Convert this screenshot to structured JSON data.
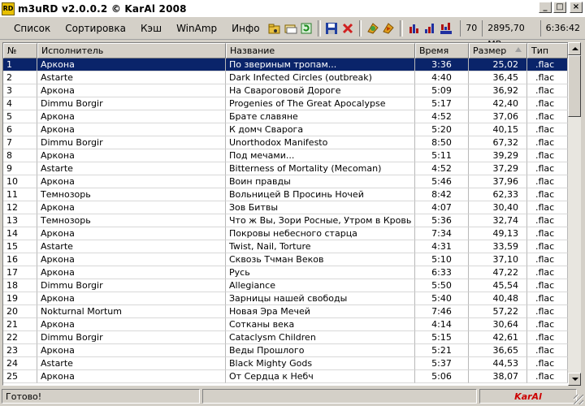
{
  "window": {
    "title": "m3uRD v2.0.0.2  © KarAl 2008",
    "icon_text": "RD"
  },
  "menu": [
    "Список",
    "Сортировка",
    "Кэш",
    "WinAmp",
    "Инфо"
  ],
  "toolbar_icons": [
    "folder-music-icon",
    "open-folder-icon",
    "refresh-icon",
    "save-icon",
    "delete-icon",
    "winamp-add-icon",
    "winamp-play-icon",
    "chart-icon",
    "chart-sorted-icon",
    "chart-random-icon"
  ],
  "stats": {
    "count": "70",
    "size": "2895,70 MB",
    "duration": "6:36:42"
  },
  "columns": [
    "№",
    "Исполнитель",
    "Название",
    "Время",
    "Размер",
    "Тип"
  ],
  "rows": [
    {
      "n": "1",
      "artist": "Аркона",
      "title": "По звериным тропам...",
      "time": "3:36",
      "size": "25,02",
      "type": ".flac"
    },
    {
      "n": "2",
      "artist": "Astarte",
      "title": "Dark Infected Circles (outbreak)",
      "time": "4:40",
      "size": "36,45",
      "type": ".flac"
    },
    {
      "n": "3",
      "artist": "Аркона",
      "title": "На Сварогововй Дороге",
      "time": "5:09",
      "size": "36,92",
      "type": ".flac"
    },
    {
      "n": "4",
      "artist": "Dimmu Borgir",
      "title": "Progenies of The Great Apocalypse",
      "time": "5:17",
      "size": "42,40",
      "type": ".flac"
    },
    {
      "n": "5",
      "artist": "Аркона",
      "title": "Брате славяне",
      "time": "4:52",
      "size": "37,06",
      "type": ".flac"
    },
    {
      "n": "6",
      "artist": "Аркона",
      "title": "К домч Сварога",
      "time": "5:20",
      "size": "40,15",
      "type": ".flac"
    },
    {
      "n": "7",
      "artist": "Dimmu Borgir",
      "title": "Unorthodox Manifesto",
      "time": "8:50",
      "size": "67,32",
      "type": ".flac"
    },
    {
      "n": "8",
      "artist": "Аркона",
      "title": "Под мечами...",
      "time": "5:11",
      "size": "39,29",
      "type": ".flac"
    },
    {
      "n": "9",
      "artist": "Astarte",
      "title": "Bitterness of Mortality (Mecoman)",
      "time": "4:52",
      "size": "37,29",
      "type": ".flac"
    },
    {
      "n": "10",
      "artist": "Аркона",
      "title": "Воин правды",
      "time": "5:46",
      "size": "37,96",
      "type": ".flac"
    },
    {
      "n": "11",
      "artist": "Темнозорь",
      "title": "Вольницей В Просинь Ночей",
      "time": "8:42",
      "size": "62,33",
      "type": ".flac"
    },
    {
      "n": "12",
      "artist": "Аркона",
      "title": "Зов Битвы",
      "time": "4:07",
      "size": "30,40",
      "type": ".flac"
    },
    {
      "n": "13",
      "artist": "Темнозорь",
      "title": "Что ж Вы, Зори Росные, Утром в Кровь Б...",
      "time": "5:36",
      "size": "32,74",
      "type": ".flac"
    },
    {
      "n": "14",
      "artist": "Аркона",
      "title": "Покровы небесного старца",
      "time": "7:34",
      "size": "49,13",
      "type": ".flac"
    },
    {
      "n": "15",
      "artist": "Astarte",
      "title": "Twist, Nail, Torture",
      "time": "4:31",
      "size": "33,59",
      "type": ".flac"
    },
    {
      "n": "16",
      "artist": "Аркона",
      "title": "Сквозь Тчман Веков",
      "time": "5:10",
      "size": "37,10",
      "type": ".flac"
    },
    {
      "n": "17",
      "artist": "Аркона",
      "title": "Русь",
      "time": "6:33",
      "size": "47,22",
      "type": ".flac"
    },
    {
      "n": "18",
      "artist": "Dimmu Borgir",
      "title": "Allegiance",
      "time": "5:50",
      "size": "45,54",
      "type": ".flac"
    },
    {
      "n": "19",
      "artist": "Аркона",
      "title": "Зарницы нашей свободы",
      "time": "5:40",
      "size": "40,48",
      "type": ".flac"
    },
    {
      "n": "20",
      "artist": "Nokturnal Mortum",
      "title": "Новая Эра Мечей",
      "time": "7:46",
      "size": "57,22",
      "type": ".flac"
    },
    {
      "n": "21",
      "artist": "Аркона",
      "title": "Сотканы века",
      "time": "4:14",
      "size": "30,64",
      "type": ".flac"
    },
    {
      "n": "22",
      "artist": "Dimmu Borgir",
      "title": "Cataclysm Children",
      "time": "5:15",
      "size": "42,61",
      "type": ".flac"
    },
    {
      "n": "23",
      "artist": "Аркона",
      "title": "Веды Прошлого",
      "time": "5:21",
      "size": "36,65",
      "type": ".flac"
    },
    {
      "n": "24",
      "artist": "Astarte",
      "title": "Black Mighty Gods",
      "time": "5:37",
      "size": "44,53",
      "type": ".flac"
    },
    {
      "n": "25",
      "artist": "Аркона",
      "title": "От Сердца к Небч",
      "time": "5:06",
      "size": "38,07",
      "type": ".flac"
    }
  ],
  "status": {
    "text": "Готово!",
    "brand": "KarAl"
  },
  "colors": {
    "selection": "#0a246a",
    "brand": "#cc0000"
  }
}
